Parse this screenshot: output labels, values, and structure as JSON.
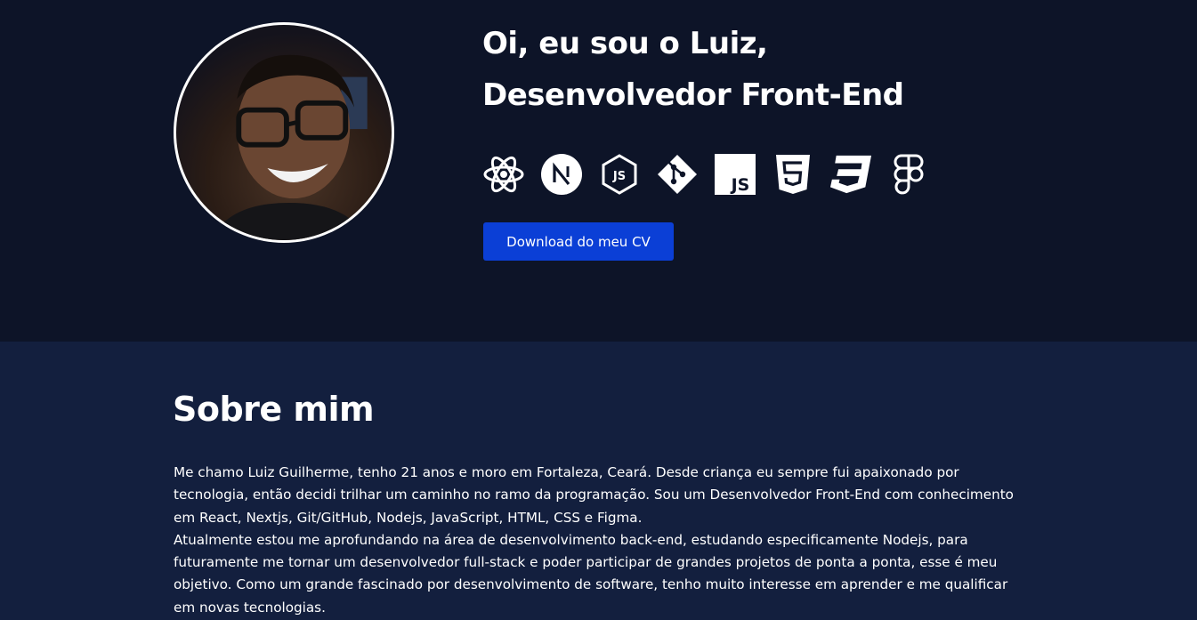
{
  "hero": {
    "title_line1": "Oi, eu sou o Luiz,",
    "title_line2": "Desenvolvedor Front-End",
    "avatar_alt": "Foto de perfil",
    "tech_icons": [
      "react-icon",
      "nextjs-icon",
      "nodejs-icon",
      "git-icon",
      "javascript-icon",
      "html5-icon",
      "css3-icon",
      "figma-icon"
    ],
    "cv_button_label": "Download do meu CV"
  },
  "about": {
    "title": "Sobre mim",
    "paragraph1": "Me chamo Luiz Guilherme, tenho 21 anos e moro em Fortaleza, Ceará. Desde criança eu sempre fui apaixonado por tecnologia, então decidi trilhar um caminho no ramo da programação. Sou um Desenvolvedor Front-End com conhecimento em React, Nextjs, Git/GitHub, Nodejs, JavaScript, HTML, CSS e Figma.",
    "paragraph2": "Atualmente estou me aprofundando na área de desenvolvimento back-end, estudando especificamente Nodejs, para futuramente me tornar um desenvolvedor full-stack e poder participar de grandes projetos de ponta a ponta, esse é meu objetivo. Como um grande fascinado por desenvolvimento de software, tenho muito interesse em aprender e me qualificar em novas tecnologias."
  },
  "colors": {
    "hero_bg": "#0d1428",
    "section_bg": "#131f3e",
    "accent": "#0b3fd6",
    "text": "#ffffff"
  }
}
